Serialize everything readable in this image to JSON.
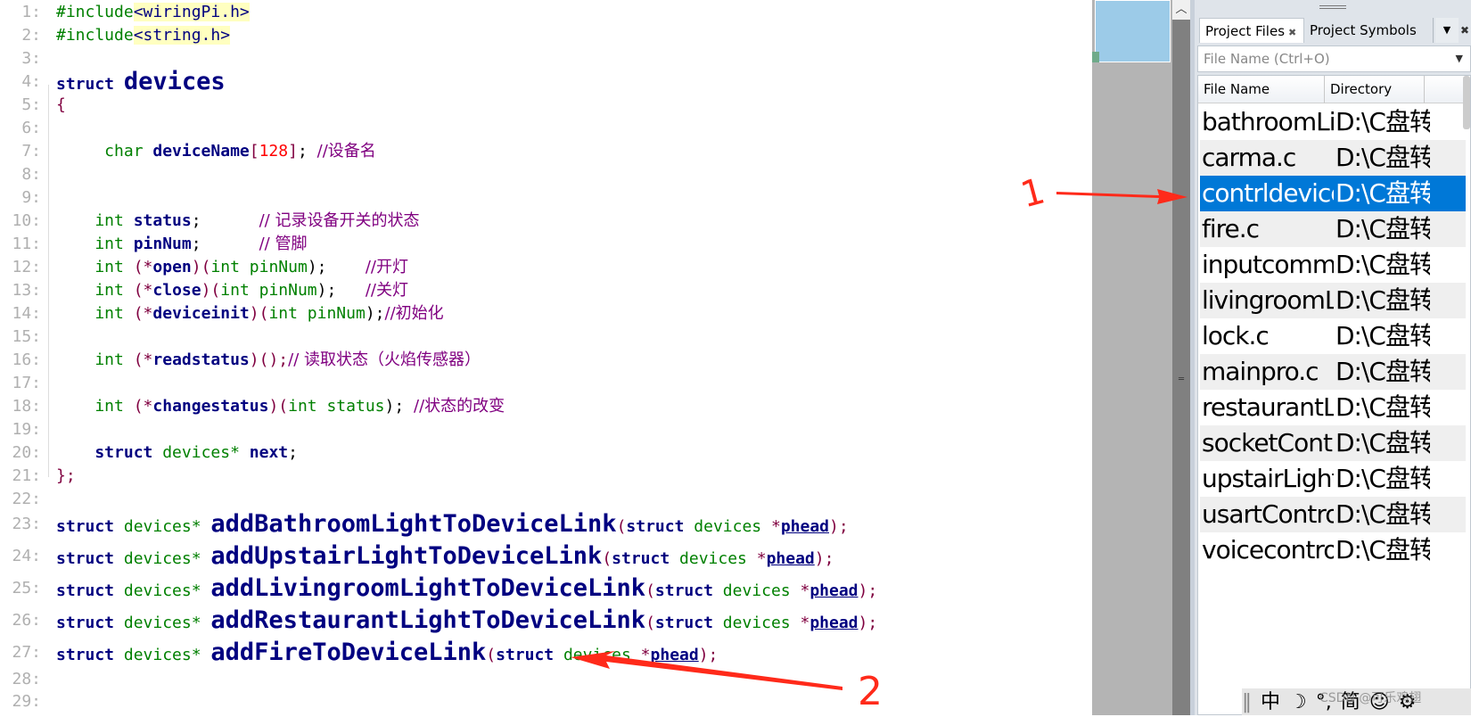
{
  "editor": {
    "lines": [
      {
        "n": "1:",
        "tokens": [
          [
            "#include",
            "pp"
          ],
          [
            "<wiringPi.h>",
            "inc"
          ]
        ]
      },
      {
        "n": "2:",
        "tokens": [
          [
            "#include",
            "pp"
          ],
          [
            "<string.h>",
            "inc"
          ]
        ]
      },
      {
        "n": "3:",
        "tokens": []
      },
      {
        "n": "4:",
        "tokens": [
          [
            "struct ",
            "kw"
          ],
          [
            "devices",
            "big"
          ]
        ]
      },
      {
        "n": "5:",
        "tokens": [
          [
            "{",
            "pu"
          ]
        ]
      },
      {
        "n": "6:",
        "tokens": []
      },
      {
        "n": "7:",
        "tokens": [
          [
            "     char ",
            "ty"
          ],
          [
            "deviceName",
            "id"
          ],
          [
            "[",
            "pu"
          ],
          [
            "128",
            "nu"
          ],
          [
            "]",
            "pu"
          ],
          [
            "; ",
            "pl"
          ],
          [
            "//设备名",
            "cm"
          ]
        ]
      },
      {
        "n": "8:",
        "tokens": []
      },
      {
        "n": "9:",
        "tokens": []
      },
      {
        "n": "10:",
        "tokens": [
          [
            "    int ",
            "ty"
          ],
          [
            "status",
            "id"
          ],
          [
            ";      ",
            "pl"
          ],
          [
            "// 记录设备开关的状态",
            "cm"
          ]
        ]
      },
      {
        "n": "11:",
        "tokens": [
          [
            "    int ",
            "ty"
          ],
          [
            "pinNum",
            "id"
          ],
          [
            ";      ",
            "pl"
          ],
          [
            "// 管脚",
            "cm"
          ]
        ]
      },
      {
        "n": "12:",
        "tokens": [
          [
            "    int ",
            "ty"
          ],
          [
            "(*",
            "pu"
          ],
          [
            "open",
            "id"
          ],
          [
            ")(",
            "pu"
          ],
          [
            "int pinNum",
            "ty"
          ],
          [
            ");    ",
            "pl"
          ],
          [
            "//开灯",
            "cm"
          ]
        ]
      },
      {
        "n": "13:",
        "tokens": [
          [
            "    int ",
            "ty"
          ],
          [
            "(*",
            "pu"
          ],
          [
            "close",
            "id"
          ],
          [
            ")(",
            "pu"
          ],
          [
            "int pinNum",
            "ty"
          ],
          [
            ");   ",
            "pl"
          ],
          [
            "//关灯",
            "cm"
          ]
        ]
      },
      {
        "n": "14:",
        "tokens": [
          [
            "    int ",
            "ty"
          ],
          [
            "(*",
            "pu"
          ],
          [
            "deviceinit",
            "id"
          ],
          [
            ")(",
            "pu"
          ],
          [
            "int pinNum",
            "ty"
          ],
          [
            ");",
            "pl"
          ],
          [
            "//初始化",
            "cm"
          ]
        ]
      },
      {
        "n": "15:",
        "tokens": []
      },
      {
        "n": "16:",
        "tokens": [
          [
            "    int ",
            "ty"
          ],
          [
            "(*",
            "pu"
          ],
          [
            "readstatus",
            "id"
          ],
          [
            ")();",
            "pu"
          ],
          [
            "// 读取状态（火焰传感器）",
            "cm"
          ]
        ]
      },
      {
        "n": "17:",
        "tokens": []
      },
      {
        "n": "18:",
        "tokens": [
          [
            "    int ",
            "ty"
          ],
          [
            "(*",
            "pu"
          ],
          [
            "changestatus",
            "id"
          ],
          [
            ")(",
            "pu"
          ],
          [
            "int status",
            "ty"
          ],
          [
            "); ",
            "pl"
          ],
          [
            "//状态的改变",
            "cm"
          ]
        ]
      },
      {
        "n": "19:",
        "tokens": []
      },
      {
        "n": "20:",
        "tokens": [
          [
            "    struct ",
            "kw"
          ],
          [
            "devices* ",
            "ty"
          ],
          [
            "next",
            "id"
          ],
          [
            ";",
            "pl"
          ]
        ]
      },
      {
        "n": "21:",
        "tokens": [
          [
            "};",
            "pu"
          ]
        ]
      },
      {
        "n": "22:",
        "tokens": []
      },
      {
        "n": "23:",
        "tokens": [
          [
            "struct ",
            "kw"
          ],
          [
            "devices* ",
            "ty"
          ],
          [
            "addBathroomLightToDeviceLink",
            "big"
          ],
          [
            "(",
            "pu"
          ],
          [
            "struct ",
            "kw"
          ],
          [
            "devices ",
            "ty"
          ],
          [
            "*",
            "pu"
          ],
          [
            "phead",
            "ul"
          ],
          [
            ");",
            "pu"
          ]
        ]
      },
      {
        "n": "24:",
        "tokens": [
          [
            "struct ",
            "kw"
          ],
          [
            "devices* ",
            "ty"
          ],
          [
            "addUpstairLightToDeviceLink",
            "big"
          ],
          [
            "(",
            "pu"
          ],
          [
            "struct ",
            "kw"
          ],
          [
            "devices ",
            "ty"
          ],
          [
            "*",
            "pu"
          ],
          [
            "phead",
            "ul"
          ],
          [
            ");",
            "pu"
          ]
        ]
      },
      {
        "n": "25:",
        "tokens": [
          [
            "struct ",
            "kw"
          ],
          [
            "devices* ",
            "ty"
          ],
          [
            "addLivingroomLightToDeviceLink",
            "big"
          ],
          [
            "(",
            "pu"
          ],
          [
            "struct ",
            "kw"
          ],
          [
            "devices ",
            "ty"
          ],
          [
            "*",
            "pu"
          ],
          [
            "phead",
            "ul"
          ],
          [
            ");",
            "pu"
          ]
        ]
      },
      {
        "n": "26:",
        "tokens": [
          [
            "struct ",
            "kw"
          ],
          [
            "devices* ",
            "ty"
          ],
          [
            "addRestaurantLightToDeviceLink",
            "big"
          ],
          [
            "(",
            "pu"
          ],
          [
            "struct ",
            "kw"
          ],
          [
            "devices ",
            "ty"
          ],
          [
            "*",
            "pu"
          ],
          [
            "phead",
            "ul"
          ],
          [
            ");",
            "pu"
          ]
        ]
      },
      {
        "n": "27:",
        "tokens": [
          [
            "struct ",
            "kw"
          ],
          [
            "devices* ",
            "ty"
          ],
          [
            "addFireToDeviceLink",
            "big"
          ],
          [
            "(",
            "pu"
          ],
          [
            "struct ",
            "kw"
          ],
          [
            "devices ",
            "ty"
          ],
          [
            "*",
            "pu"
          ],
          [
            "phead",
            "ul"
          ],
          [
            ");",
            "pu"
          ]
        ]
      },
      {
        "n": "28:",
        "tokens": []
      },
      {
        "n": "29:",
        "tokens": []
      }
    ]
  },
  "panel": {
    "tabs": [
      {
        "label": "Project Files",
        "active": true
      },
      {
        "label": "Project Symbols",
        "active": false
      }
    ],
    "filter_placeholder": "File Name (Ctrl+O)",
    "columns": [
      "File Name",
      "Directory"
    ],
    "rows": [
      {
        "name": "bathroomLight.c",
        "dir": "D:\\C盘转"
      },
      {
        "name": "carma.c",
        "dir": "D:\\C盘转"
      },
      {
        "name": "contrldevices.h",
        "dir": "D:\\C盘转",
        "selected": true
      },
      {
        "name": "fire.c",
        "dir": "D:\\C盘转"
      },
      {
        "name": "inputcommand.h",
        "dir": "D:\\C盘转"
      },
      {
        "name": "livingroomLight.c",
        "dir": "D:\\C盘转"
      },
      {
        "name": "lock.c",
        "dir": "D:\\C盘转"
      },
      {
        "name": "mainpro.c",
        "dir": "D:\\C盘转"
      },
      {
        "name": "restaurantLight.c",
        "dir": "D:\\C盘转"
      },
      {
        "name": "socketControl.c",
        "dir": "D:\\C盘转"
      },
      {
        "name": "upstairLight.c",
        "dir": "D:\\C盘转"
      },
      {
        "name": "usartControl.c",
        "dir": "D:\\C盘转"
      },
      {
        "name": "voicecontrol.c",
        "dir": "D:\\C盘转"
      }
    ],
    "selected_color": "#0078d7"
  },
  "ime": {
    "items": [
      "中",
      "☽",
      "°,",
      "简",
      "☺",
      "⚙"
    ]
  },
  "watermark": "CSDN @可乐鸡翅",
  "annotations": {
    "label1": "1",
    "label2": "2",
    "color": "#ff2a1a"
  }
}
